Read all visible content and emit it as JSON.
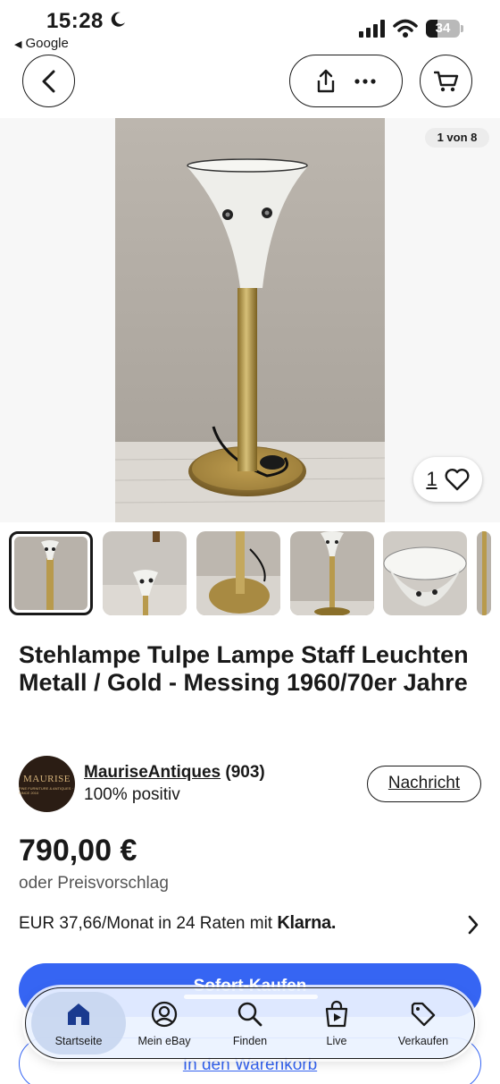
{
  "status_bar": {
    "time": "15:28",
    "back_app": "Google",
    "battery": "34",
    "icons": [
      "moon-icon",
      "cellular-signal-icon",
      "wifi-icon",
      "battery-icon"
    ]
  },
  "top_nav": {
    "icons": [
      "chevron-left-icon",
      "share-icon",
      "more-icon",
      "cart-icon"
    ]
  },
  "gallery": {
    "counter": "1 von 8",
    "watch_count": "1",
    "thumbnail_count": 6
  },
  "listing": {
    "title": "Stehlampe Tulpe Lampe Staff Leuchten Metall / Gold - Messing 1960/70er Jahre"
  },
  "seller": {
    "avatar_text": "MAURISE",
    "avatar_subtext": "FINE FURNITURE & ANTIQUES · SINCE 2010",
    "name": "MauriseAntiques",
    "rating_count": "(903)",
    "feedback": "100% positiv",
    "message_label": "Nachricht"
  },
  "price": {
    "amount": "790,00 €",
    "offer": "oder Preisvorschlag",
    "installments": "EUR 37,66/Monat in 24 Raten mit",
    "klarna": "Klarna."
  },
  "actions": {
    "buy_now": "Sofort-Kaufen",
    "add_to_cart": "In den Warenkorb"
  },
  "bottom_nav": {
    "items": [
      {
        "label": "Startseite",
        "icon": "home-icon",
        "active": true
      },
      {
        "label": "Mein eBay",
        "icon": "user-circle-icon"
      },
      {
        "label": "Finden",
        "icon": "search-icon"
      },
      {
        "label": "Live",
        "icon": "live-bag-icon"
      },
      {
        "label": "Verkaufen",
        "icon": "tag-icon"
      }
    ]
  },
  "colors": {
    "primary_blue": "#3665f3",
    "text": "#191919",
    "secondary_text": "#555555"
  }
}
